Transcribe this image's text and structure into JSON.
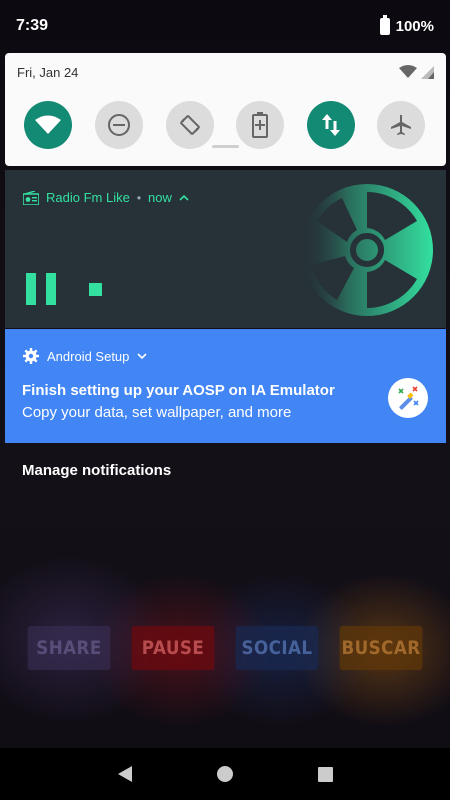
{
  "status_bar": {
    "time": "7:39",
    "battery": "100%"
  },
  "quick_settings": {
    "date": "Fri, Jan 24",
    "tiles": [
      {
        "icon": "wifi-icon",
        "active": true
      },
      {
        "icon": "do-not-disturb-icon",
        "active": false
      },
      {
        "icon": "auto-rotate-icon",
        "active": false
      },
      {
        "icon": "battery-saver-icon",
        "active": false
      },
      {
        "icon": "mobile-data-icon",
        "active": true
      },
      {
        "icon": "airplane-mode-icon",
        "active": false
      }
    ],
    "colors": {
      "active": "#138a73",
      "inactive": "#dcdcdc"
    }
  },
  "media_notification": {
    "app_name": "Radio Fm Like",
    "separator": "•",
    "time": "now",
    "accent": "#33e0a0",
    "background": "#263238"
  },
  "setup_notification": {
    "app_name": "Android Setup",
    "title": "Finish setting up your AOSP on IA Emulator",
    "text": "Copy your data, set wallpaper, and more",
    "background": "#4285f4"
  },
  "manage_notifications": "Manage notifications",
  "background_buttons": {
    "share": "SHARE",
    "pause": "PAUSE",
    "social": "SOCIAL",
    "buscar": "BUSCAR"
  }
}
